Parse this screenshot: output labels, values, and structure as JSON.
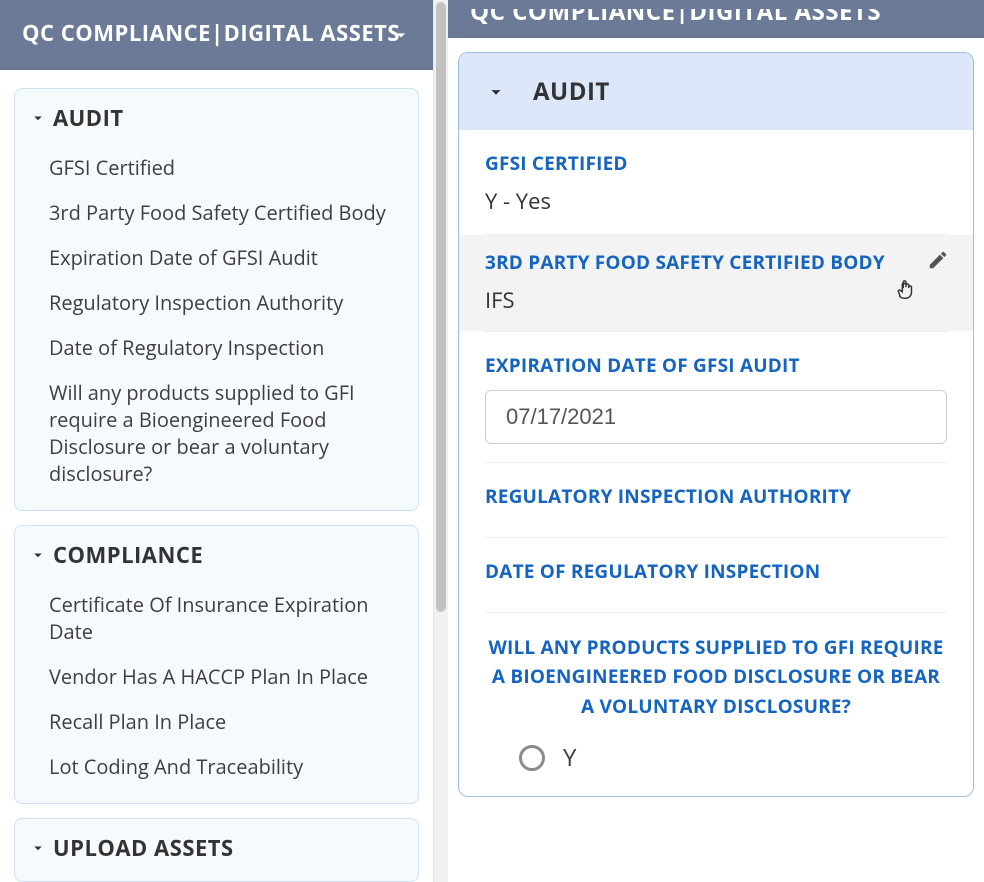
{
  "left": {
    "title": "QC COMPLIANCE|DIGITAL ASSETS",
    "sections": [
      {
        "head": "AUDIT",
        "items": [
          "GFSI Certified",
          "3rd Party Food Safety Certified Body",
          "Expiration Date of GFSI Audit",
          "Regulatory Inspection Authority",
          "Date of Regulatory Inspection",
          "Will any products supplied to GFI require a Bioengineered Food Disclosure or bear a voluntary disclosure?"
        ]
      },
      {
        "head": "COMPLIANCE",
        "items": [
          "Certificate Of Insurance Expiration Date",
          "Vendor Has A HACCP Plan In Place",
          "Recall Plan In Place",
          "Lot Coding And Traceability"
        ]
      },
      {
        "head": "UPLOAD ASSETS",
        "items": []
      }
    ]
  },
  "right": {
    "title": "QC COMPLIANCE|DIGITAL ASSETS",
    "section_head": "AUDIT",
    "fields": {
      "gfsi_certified": {
        "label": "GFSI CERTIFIED",
        "value": "Y - Yes"
      },
      "third_party_body": {
        "label": "3RD PARTY FOOD SAFETY CERTIFIED BODY",
        "value": "IFS"
      },
      "expiration_date": {
        "label": "EXPIRATION DATE OF GFSI AUDIT",
        "value": "07/17/2021"
      },
      "reg_authority": {
        "label": "REGULATORY INSPECTION AUTHORITY",
        "value": ""
      },
      "reg_date": {
        "label": "DATE OF REGULATORY INSPECTION",
        "value": ""
      },
      "bioengineered": {
        "label": "WILL ANY PRODUCTS SUPPLIED TO GFI REQUIRE A BIOENGINEERED FOOD DISCLOSURE OR BEAR A VOLUNTARY DISCLOSURE?",
        "options": [
          "Y"
        ]
      }
    }
  }
}
